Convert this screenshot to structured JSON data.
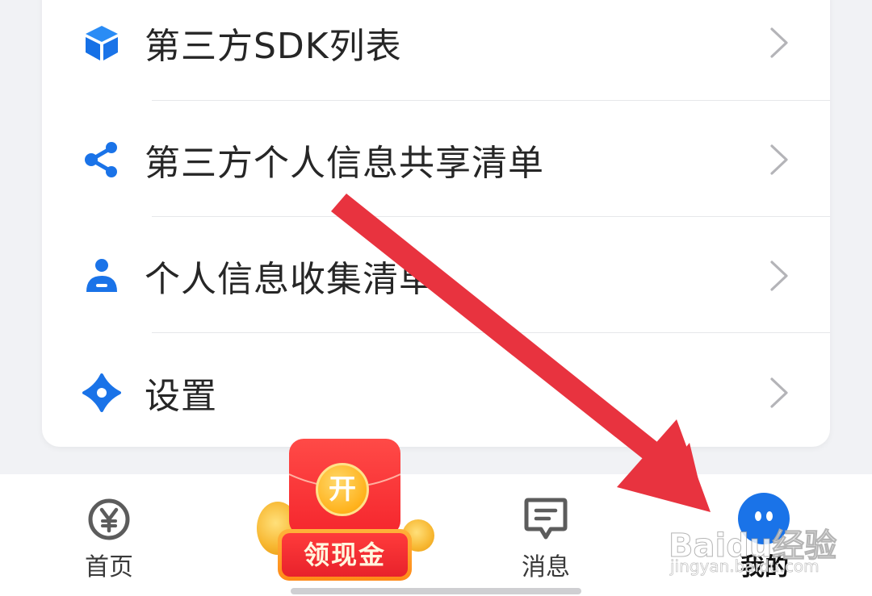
{
  "menu": {
    "items": [
      {
        "label": "第三方SDK列表",
        "icon": "cube-icon"
      },
      {
        "label": "第三方个人信息共享清单",
        "icon": "share-icon"
      },
      {
        "label": "个人信息收集清单",
        "icon": "person-icon"
      },
      {
        "label": "设置",
        "icon": "settings-icon"
      }
    ]
  },
  "bottom_nav": {
    "home": {
      "label": "首页",
      "icon": "yuan-circle-icon"
    },
    "promo": {
      "badge": "开",
      "label": "领现金",
      "icon": "red-envelope-icon"
    },
    "messages": {
      "label": "消息",
      "icon": "message-bubble-icon"
    },
    "mine": {
      "label": "我的",
      "icon": "avatar-icon"
    }
  },
  "watermark": {
    "logo": "Baidu经验",
    "url": "jingyan.baidu.com"
  },
  "colors": {
    "accent_blue": "#1a73e8",
    "annotation_arrow": "#e8333f",
    "promo_red": "#f5262d",
    "text_primary": "#262626"
  }
}
